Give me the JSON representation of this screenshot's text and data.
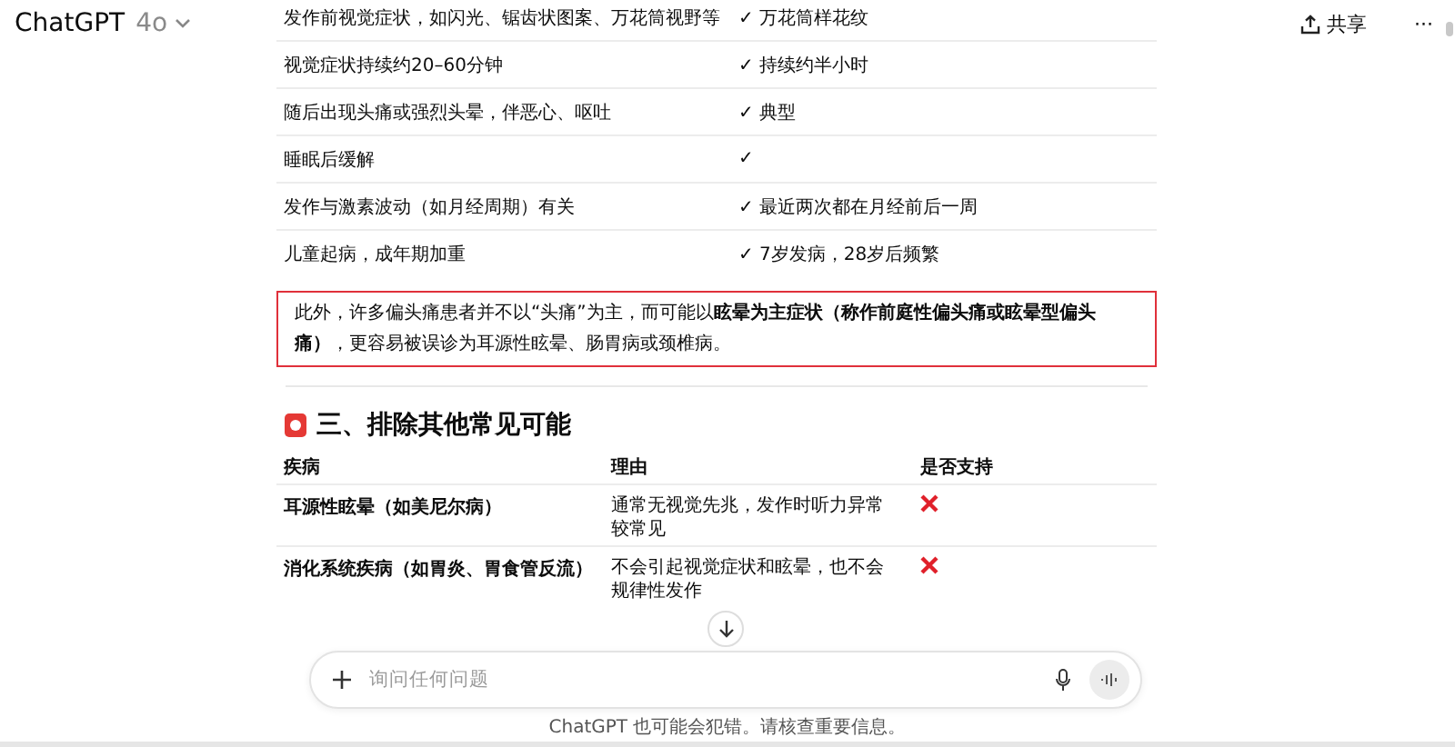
{
  "header": {
    "title": "ChatGPT",
    "model": "4o",
    "share": "共享",
    "more": "···"
  },
  "symptom_table": {
    "rows": [
      {
        "cells": [
          "发作前视觉症状，如闪光、锯齿状图案、万花筒视野等",
          "✓ 万花筒样花纹"
        ]
      },
      {
        "cells": [
          "视觉症状持续约20–60分钟",
          "✓ 持续约半小时"
        ]
      },
      {
        "cells": [
          "随后出现头痛或强烈头晕，伴恶心、呕吐",
          "✓ 典型"
        ]
      },
      {
        "cells": [
          "睡眠后缓解",
          "✓"
        ]
      },
      {
        "cells": [
          "发作与激素波动（如月经周期）有关",
          "✓ 最近两次都在月经前后一周"
        ]
      },
      {
        "cells": [
          "儿童起病，成年期加重",
          "✓ 7岁发病，28岁后频繁"
        ]
      }
    ]
  },
  "callout": {
    "text": "此外，许多偏头痛患者并不以“头痛”为主，而可能以**眩晕为主症状（称作前庭性偏头痛或眩晕型偏头痛）**，更容易被误诊为耳源性眩晕、肠胃病或颈椎病。"
  },
  "section": {
    "heading": "三、排除其他常见可能"
  },
  "exclusion_table": {
    "columns": [
      "疾病",
      "理由",
      "是否支持"
    ],
    "rows": [
      {
        "disease": "耳源性眩晕（如美尼尔病）",
        "reason": "通常无视觉先兆，发作时听力异常较常见",
        "supported": false
      },
      {
        "disease": "消化系统疾病（如胃炎、胃食管反流）",
        "reason": "不会引起视觉症状和眩晕，也不会规律性发作",
        "supported": false
      }
    ]
  },
  "composer": {
    "placeholder": "询问任何问题"
  },
  "footer": {
    "disclaimer": "ChatGPT 也可能会犯错。请核查重要信息。"
  }
}
